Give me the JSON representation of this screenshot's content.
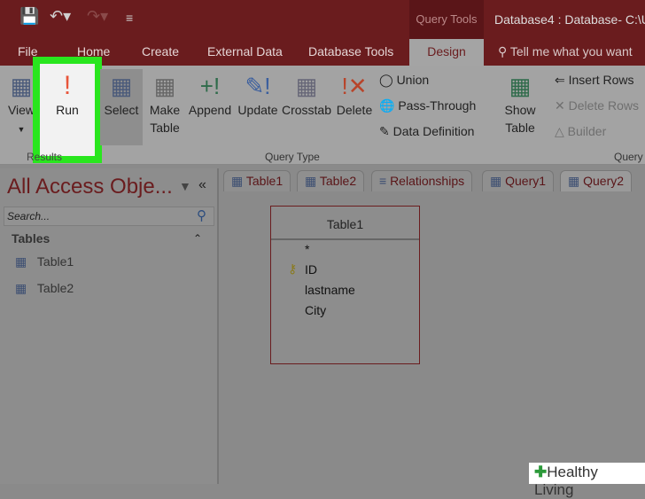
{
  "title": {
    "context": "Query Tools",
    "window": "Database4 : Database- C:\\U"
  },
  "tabs": [
    "File",
    "Home",
    "Create",
    "External Data",
    "Database Tools",
    "Design"
  ],
  "tell_me": "Tell me what you want",
  "ribbon": {
    "results": {
      "view": "View",
      "run": "Run",
      "group": "Results"
    },
    "query_type": {
      "select": "Select",
      "make_table": [
        "Make",
        "Table"
      ],
      "append": "Append",
      "update": "Update",
      "crosstab": "Crosstab",
      "delete": "Delete",
      "union": "Union",
      "pass_through": "Pass-Through",
      "data_definition": "Data Definition",
      "group": "Query Type"
    },
    "setup": {
      "show_table": [
        "Show",
        "Table"
      ],
      "insert_rows": "Insert Rows",
      "delete_rows": "Delete Rows",
      "builder": "Builder",
      "group": "Query"
    }
  },
  "nav": {
    "title": "All Access Obje...",
    "search_placeholder": "Search...",
    "section": "Tables",
    "items": [
      "Table1",
      "Table2"
    ]
  },
  "doc_tabs": [
    "Table1",
    "Table2",
    "Relationships",
    "Query1",
    "Query2"
  ],
  "table_box": {
    "title": "Table1",
    "fields": [
      "*",
      "ID",
      "lastname",
      "City"
    ]
  },
  "watermark": "Healthy Living",
  "colors": {
    "highlight": "#29e61e",
    "brand": "#6a1c1e"
  }
}
